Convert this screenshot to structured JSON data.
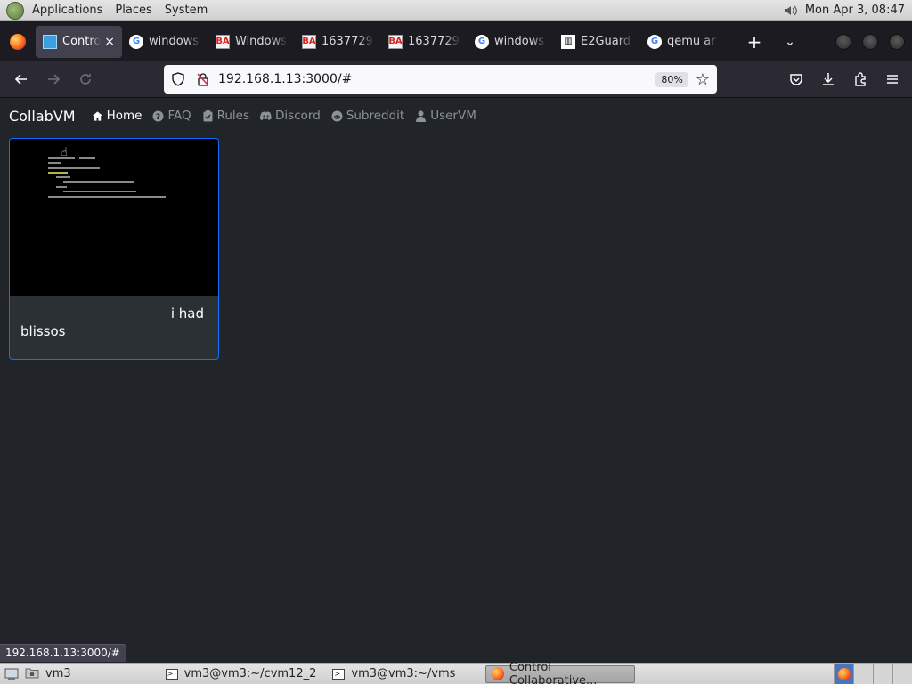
{
  "top_panel": {
    "menus": [
      "Applications",
      "Places",
      "System"
    ],
    "clock": "Mon Apr  3, 08:47"
  },
  "tabs": [
    {
      "title": "Contro",
      "favicon": "vm-icon",
      "active": true
    },
    {
      "title": "windows",
      "favicon": "google-icon",
      "active": false
    },
    {
      "title": "Windows",
      "favicon": "betaarchive-icon",
      "active": false
    },
    {
      "title": "1637729",
      "favicon": "betaarchive-icon",
      "active": false
    },
    {
      "title": "1637729",
      "favicon": "betaarchive-icon",
      "active": false
    },
    {
      "title": "windows",
      "favicon": "google-icon",
      "active": false
    },
    {
      "title": "E2Guard",
      "favicon": "e2guardian-icon",
      "active": false
    },
    {
      "title": "qemu ar",
      "favicon": "google-icon",
      "active": false
    }
  ],
  "tab_controls": {
    "new_tab": "+",
    "all_tabs": "⌄",
    "close": "×"
  },
  "urlbar": {
    "url": "192.168.1.13:3000/#",
    "zoom": "80%"
  },
  "site": {
    "brand": "CollabVM",
    "nav": [
      {
        "label": "Home",
        "icon": "home-icon",
        "active": true
      },
      {
        "label": "FAQ",
        "icon": "question-circle-icon",
        "active": false
      },
      {
        "label": "Rules",
        "icon": "clipboard-check-icon",
        "active": false
      },
      {
        "label": "Discord",
        "icon": "discord-icon",
        "active": false
      },
      {
        "label": "Subreddit",
        "icon": "reddit-icon",
        "active": false
      },
      {
        "label": "UserVM",
        "icon": "user-icon",
        "active": false
      }
    ],
    "vm_card": {
      "description_line1": "i had",
      "description_line2": "blissos"
    }
  },
  "status_text": "192.168.1.13:3000/#",
  "bottom_panel": {
    "tasks": [
      {
        "label": "vm3",
        "icon": "home-folder-icon",
        "active": false
      },
      {
        "label": "vm3@vm3:~/cvm12_2",
        "icon": "terminal-icon",
        "active": false
      },
      {
        "label": "vm3@vm3:~/vms",
        "icon": "terminal-icon",
        "active": false
      },
      {
        "label": "Control Collaborative...",
        "icon": "firefox-icon",
        "active": true
      }
    ]
  },
  "colors": {
    "page_bg": "#212529",
    "card_border": "#0d6efd",
    "toolbar": "#2b2a33",
    "tabstrip": "#1c1b22"
  }
}
